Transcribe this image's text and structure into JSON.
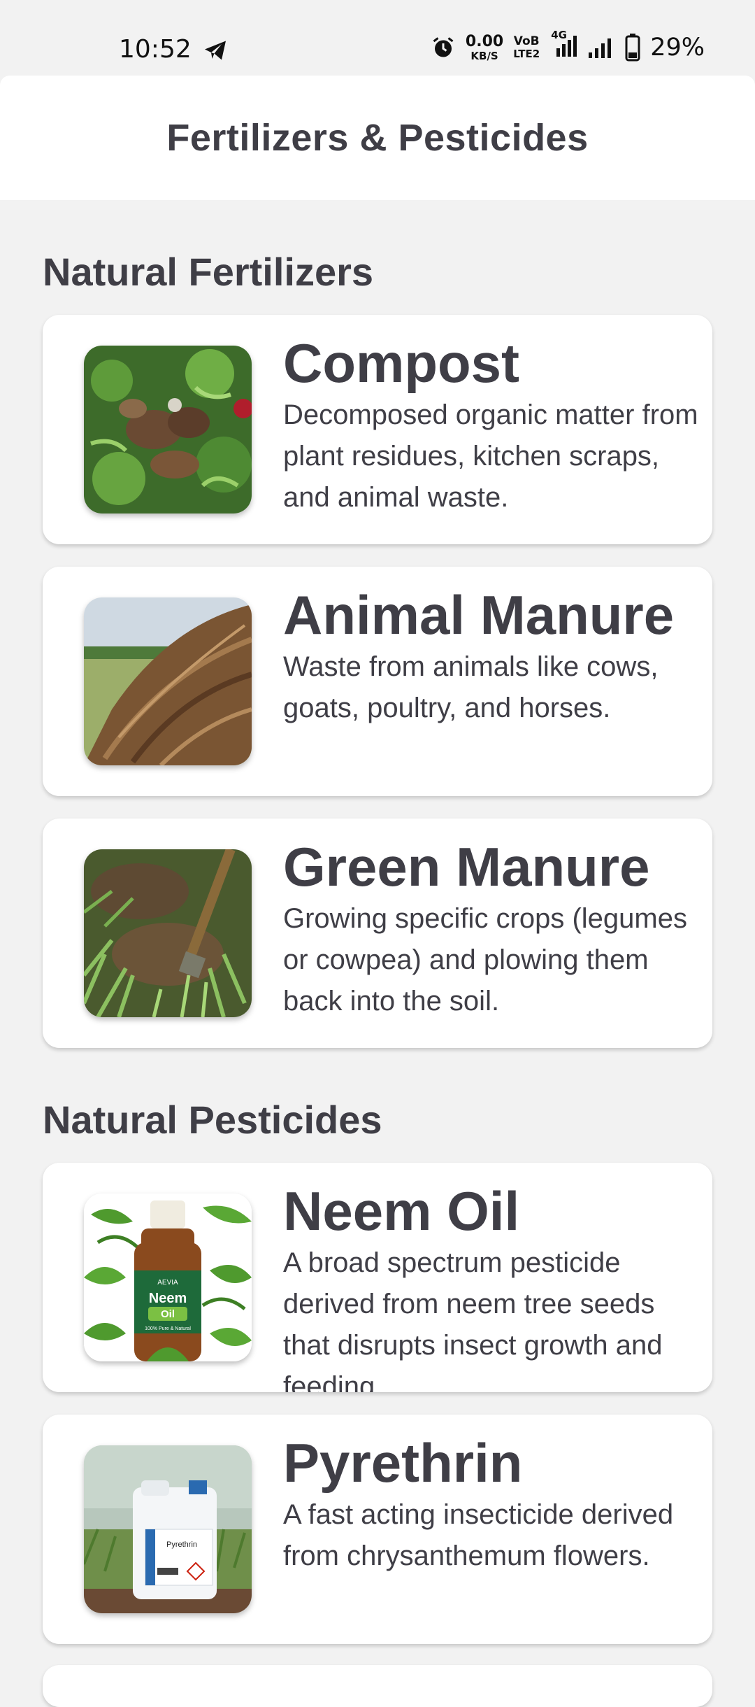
{
  "status_bar": {
    "time": "10:52",
    "net_speed_value": "0.00",
    "net_speed_unit": "KB/S",
    "volte_top": "VoB",
    "volte_bottom": "LTE2",
    "network_type": "4G",
    "battery_percent": "29%",
    "icons": [
      "telegram-icon",
      "alarm-icon",
      "signal-icon",
      "signal-icon",
      "battery-icon"
    ]
  },
  "header": {
    "title": "Fertilizers & Pesticides"
  },
  "sections": [
    {
      "title": "Natural Fertilizers",
      "items": [
        {
          "title": "Compost",
          "description": "Decomposed organic matter from plant residues, kitchen scraps, and animal waste.",
          "image": "compost-image"
        },
        {
          "title": "Animal Manure",
          "description": "Waste from animals like cows, goats, poultry, and horses.",
          "image": "animal-manure-image"
        },
        {
          "title": "Green Manure",
          "description": "Growing specific crops (legumes or cowpea) and plowing them back into the soil.",
          "image": "green-manure-image"
        }
      ]
    },
    {
      "title": "Natural Pesticides",
      "items": [
        {
          "title": "Neem Oil",
          "description": "A broad spectrum pesticide derived from neem tree seeds that disrupts insect growth and feeding.",
          "image": "neem-oil-image",
          "image_text": {
            "brand": "AEVIA",
            "name": "Neem",
            "sub": "Oil",
            "tagline": "100% Pure & Natural"
          }
        },
        {
          "title": "Pyrethrin",
          "description": "A fast acting insecticide derived from chrysanthemum flowers.",
          "image": "pyrethrin-image",
          "image_text": {
            "label": "Pyrethrin"
          }
        }
      ]
    }
  ],
  "colors": {
    "background": "#f2f2f2",
    "card": "#ffffff",
    "text": "#3f3e46"
  }
}
